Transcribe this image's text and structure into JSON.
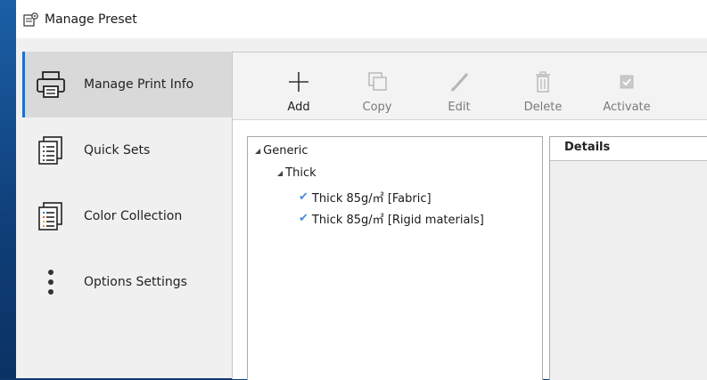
{
  "window": {
    "title": "Manage Preset"
  },
  "sidebar": {
    "items": [
      {
        "label": "Manage Print Info",
        "icon": "printer-icon",
        "active": true
      },
      {
        "label": "Quick Sets",
        "icon": "quick-sets-icon",
        "active": false
      },
      {
        "label": "Color Collection",
        "icon": "color-collection-icon",
        "active": false
      },
      {
        "label": "Options Settings",
        "icon": "vertical-dots-icon",
        "active": false
      }
    ]
  },
  "toolbar": {
    "add_label": "Add",
    "copy_label": "Copy",
    "edit_label": "Edit",
    "delete_label": "Delete",
    "activate_label": "Activate"
  },
  "tree": {
    "root": "Generic",
    "group": "Thick",
    "items": [
      {
        "label": "Thick 85g/㎡ [Fabric]",
        "checked": true
      },
      {
        "label": "Thick 85g/㎡ [Rigid materials]",
        "checked": true
      }
    ]
  },
  "details": {
    "header": "Details"
  },
  "colors": {
    "accent": "#1e6fc9",
    "check": "#4a8ad8",
    "desktop": "#0d3a6e"
  }
}
